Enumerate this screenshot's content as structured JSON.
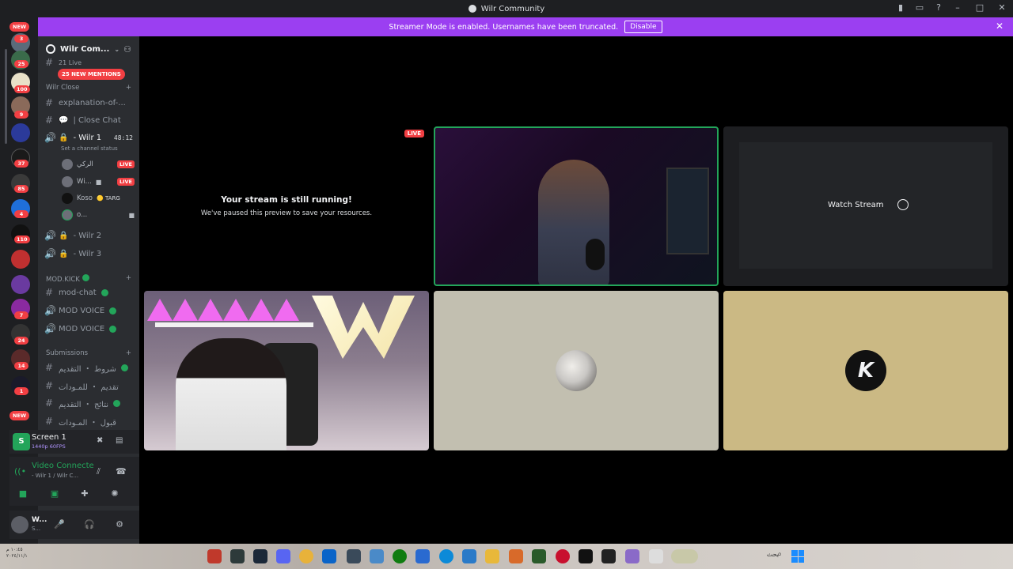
{
  "window": {
    "title": "Wilr Community"
  },
  "banner": {
    "text": "Streamer Mode is enabled. Usernames have been truncated.",
    "disable_label": "Disable"
  },
  "rail": {
    "new_top": "NEW",
    "new_bottom": "NEW",
    "badges": [
      "3",
      "25",
      "100",
      "9",
      "37",
      "85",
      "4",
      "110",
      "7",
      "24",
      "14",
      "1"
    ]
  },
  "guild": {
    "name": "Wilr Com..."
  },
  "mentions_pill": "25 NEW MENTIONS",
  "truncated_row": "21 Live",
  "categories": {
    "wilr_close": "Wilr Close",
    "mod_kick": "MOD.KICK",
    "submissions": "Submissions"
  },
  "channels": {
    "explanation": "explanation-of-...",
    "close_chat": "| Close  Chat",
    "wilr1": "- Wilr 1",
    "wilr1_timer": "48:12",
    "set_status": "Set a channel status",
    "wilr2": "- Wilr 2",
    "wilr3": "- Wilr 3",
    "mod_chat": "mod-chat",
    "mod_voice_1": "MOD VOICE",
    "mod_voice_2": "MOD VOICE",
    "sub1": "شروط ・ التقديم",
    "sub2": "تقديم ・ للمـودات",
    "sub3": "نتائج ・ التقديم",
    "sub4": "قبول ・ المـودات"
  },
  "voice_users": [
    {
      "name": "الركي",
      "live": "LIVE"
    },
    {
      "name": "Wi...",
      "live": "LIVE"
    },
    {
      "name": "Koso",
      "tag": "TARG"
    },
    {
      "name": "o..."
    }
  ],
  "screen_panel": {
    "title": "Screen 1",
    "sub": "1440p 60FPS"
  },
  "voice_panel": {
    "status": "Video Connecte",
    "channel": "- Wilr 1 / Wilr C..."
  },
  "user_panel": {
    "name": "W...",
    "status": "S..."
  },
  "stage": {
    "paused_title": "Your stream is still running!",
    "paused_desc": "We've paused this preview to save your resources.",
    "live_badge": "LIVE",
    "watch_label": "Watch Stream",
    "u2_letter": "K"
  },
  "taskbar": {
    "search": "بحث",
    "date_line1": "١٠:٤٥ م",
    "date_line2": "٢٠٢٤/١١/١"
  },
  "colors": {
    "accent": "#9b3ff1",
    "live": "#f23f43",
    "online": "#23a55a"
  }
}
